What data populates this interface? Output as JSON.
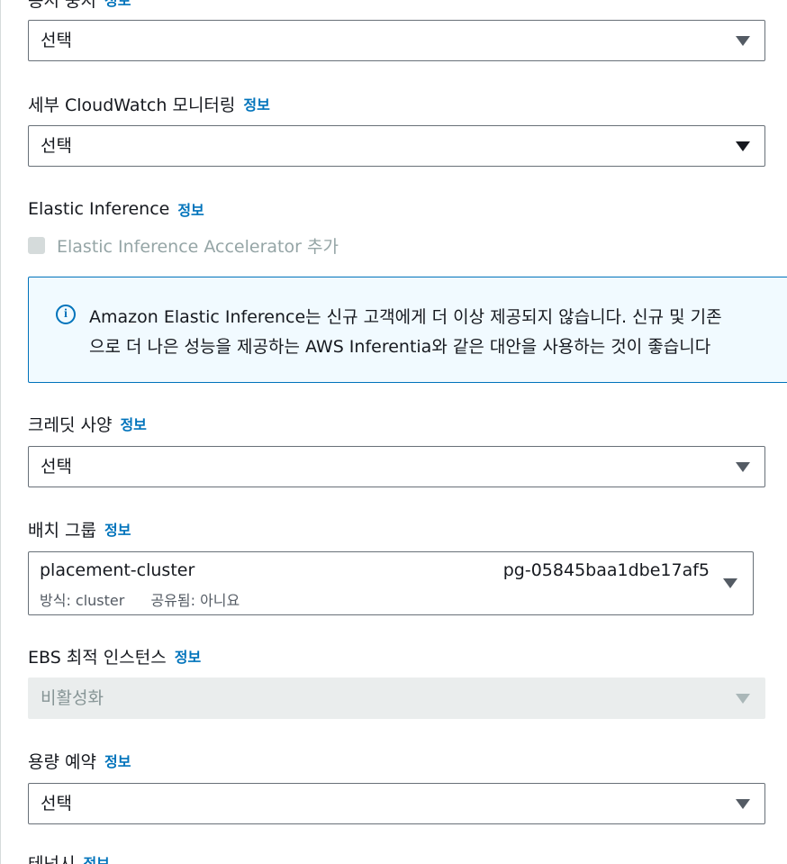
{
  "top_field": {
    "label": "종시 중지",
    "info": "정보",
    "select_value": "선택"
  },
  "cloudwatch": {
    "label": "세부 CloudWatch 모니터링",
    "info": "정보",
    "select_value": "선택"
  },
  "elastic_inference": {
    "label": "Elastic Inference",
    "info": "정보",
    "checkbox_label": "Elastic Inference Accelerator 추가",
    "checkbox_checked": false,
    "alert": {
      "line1": "Amazon Elastic Inference는 신규 고객에게 더 이상 제공되지 않습니다. 신규 및 기존",
      "line2": "으로 더 나은 성능을 제공하는 AWS Inferentia와 같은 대안을 사용하는 것이 좋습니다"
    }
  },
  "credit_spec": {
    "label": "크레딧 사양",
    "info": "정보",
    "select_value": "선택"
  },
  "placement_group": {
    "label": "배치 그룹",
    "info": "정보",
    "name": "placement-cluster",
    "id": "pg-05845baa1dbe17af5",
    "strategy": "방식: cluster",
    "shared": "공유됨: 아니요"
  },
  "ebs_optimized": {
    "label": "EBS 최적 인스턴스",
    "info": "정보",
    "select_value": "비활성화",
    "disabled": true
  },
  "capacity_reservation": {
    "label": "용량 예약",
    "info": "정보",
    "select_value": "선택"
  },
  "bottom_field": {
    "label": "테넌시",
    "info": "정보"
  }
}
